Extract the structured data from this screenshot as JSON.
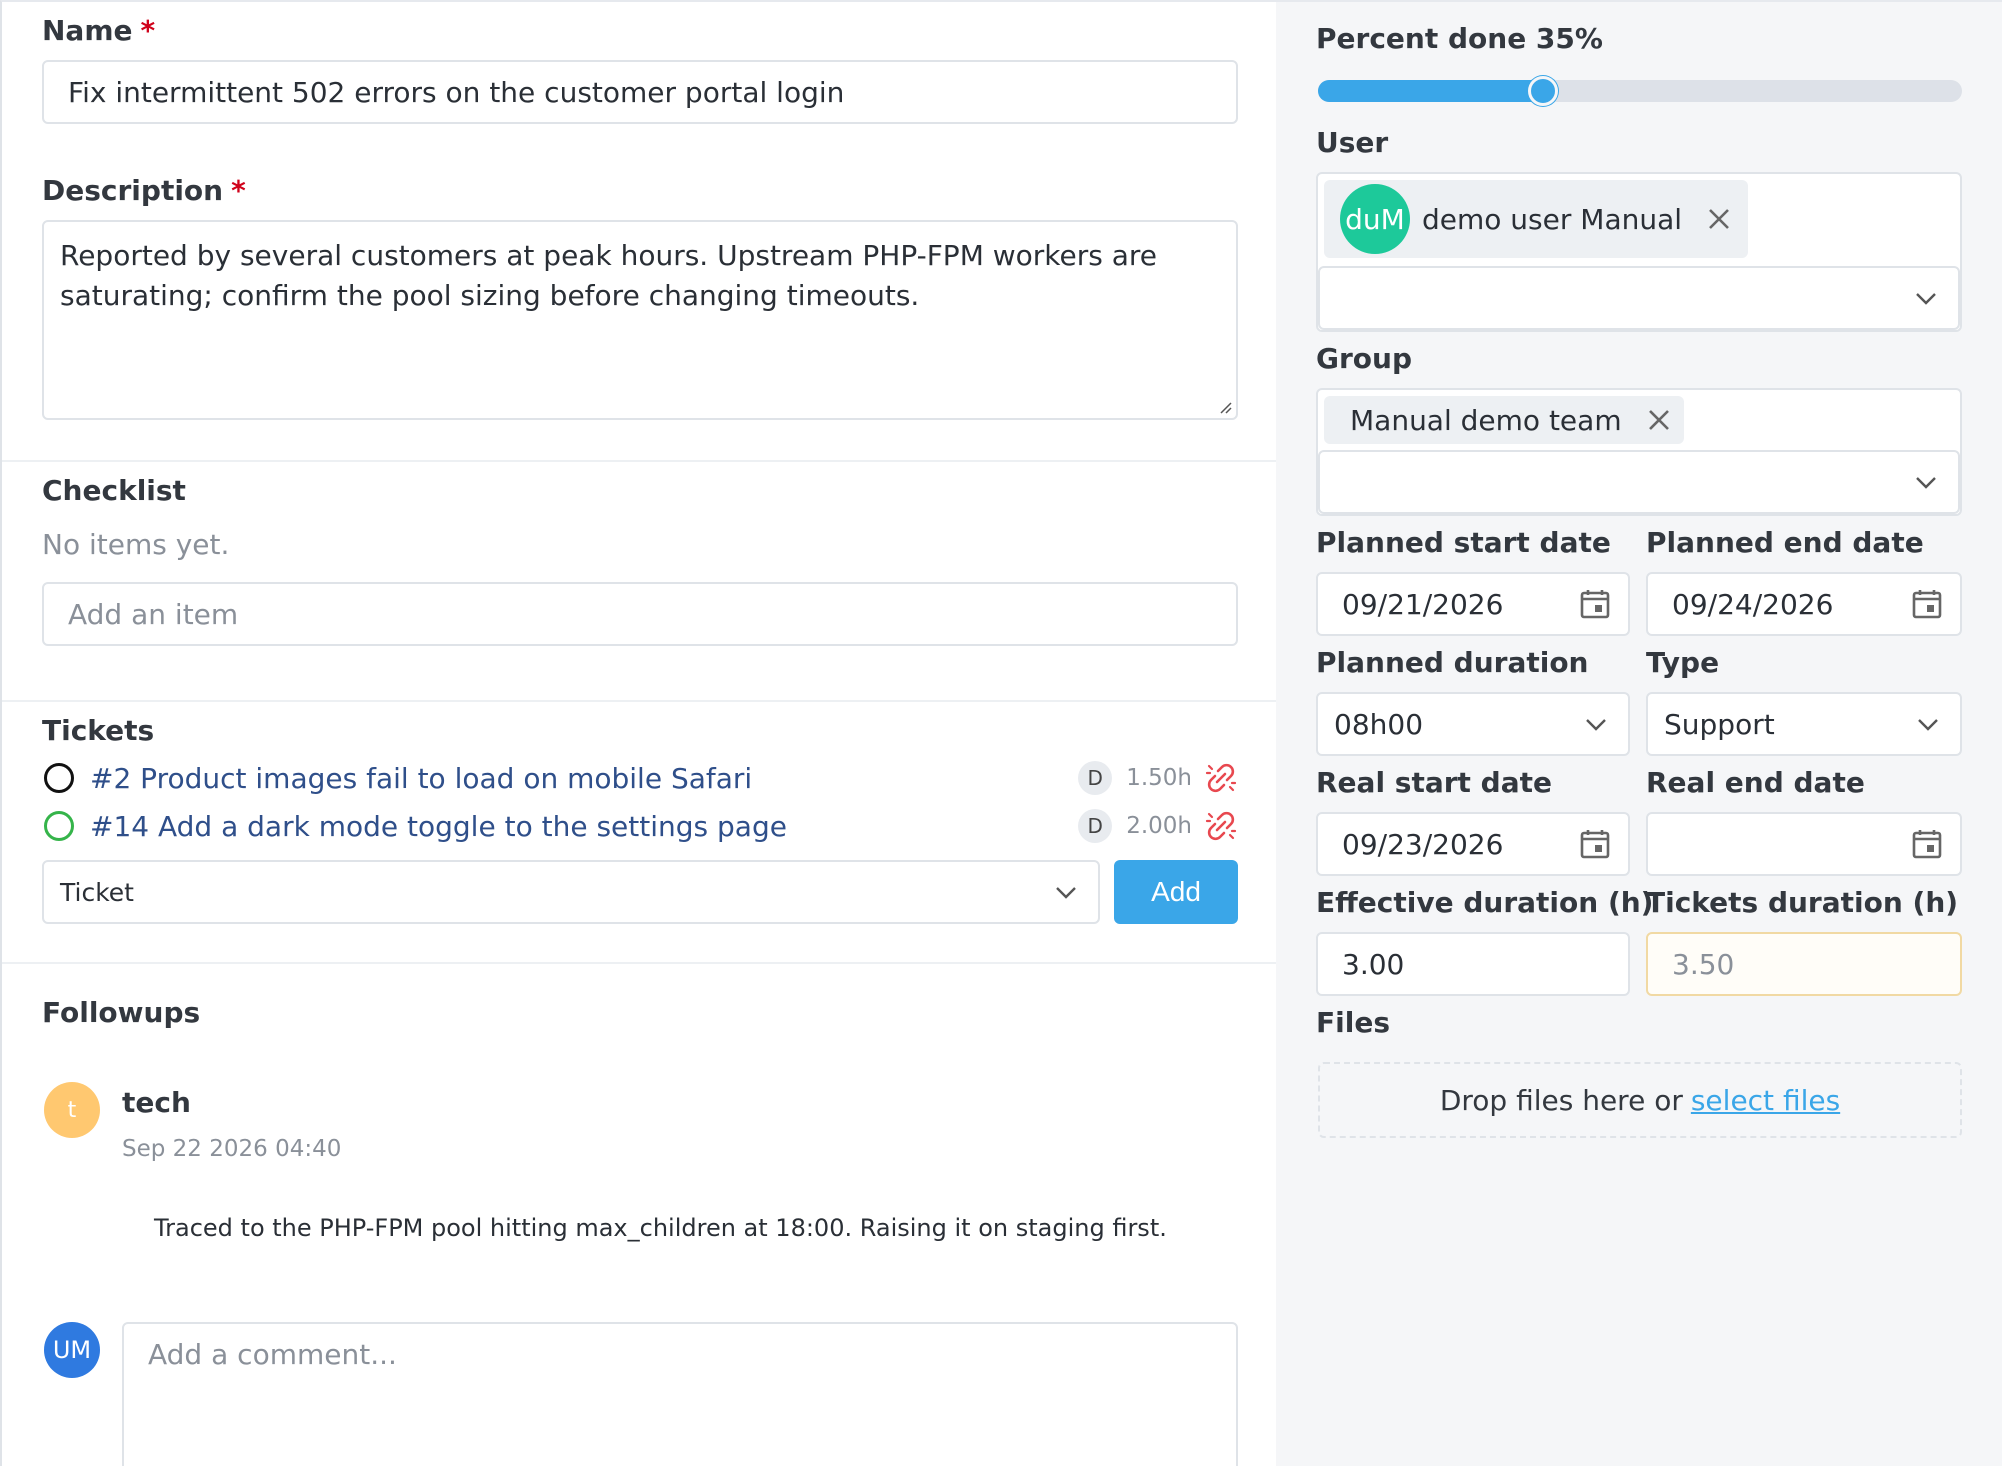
{
  "form": {
    "name_label": "Name",
    "required_mark": "*",
    "name_value": "Fix intermittent 502 errors on the customer portal login",
    "description_label": "Description",
    "description_value": "Reported by several customers at peak hours. Upstream PHP-FPM workers are saturating; confirm the pool sizing before changing timeouts."
  },
  "checklist": {
    "label": "Checklist",
    "empty_text": "No items yet.",
    "add_placeholder": "Add an item"
  },
  "tickets": {
    "label": "Tickets",
    "items": [
      {
        "title": "#2 Product images fail to load on mobile Safari",
        "badge": "D",
        "duration": "1.50h",
        "status_color": "#111111"
      },
      {
        "title": "#14 Add a dark mode toggle to the settings page",
        "badge": "D",
        "duration": "2.00h",
        "status_color": "#35b44a"
      }
    ],
    "select_placeholder": "Ticket",
    "add_label": "Add"
  },
  "followups": {
    "label": "Followups",
    "items": [
      {
        "avatar_initial": "t",
        "author": "tech",
        "date": "Sep 22 2026 04:40",
        "content": "Traced to the PHP-FPM pool hitting max_children at 18:00. Raising it on staging first."
      }
    ],
    "current_user_initials": "UM",
    "comment_placeholder": "Add a comment..."
  },
  "sidebar": {
    "percent_label": "Percent done 35%",
    "percent_value": 35,
    "user_label": "User",
    "user_chip": {
      "initials": "duM",
      "name": "demo user Manual"
    },
    "group_label": "Group",
    "group_chip": {
      "name": "Manual demo team"
    },
    "planned_start_label": "Planned start date",
    "planned_start_value": "09/21/2026",
    "planned_end_label": "Planned end date",
    "planned_end_value": "09/24/2026",
    "planned_duration_label": "Planned duration",
    "planned_duration_value": "08h00",
    "type_label": "Type",
    "type_value": "Support",
    "real_start_label": "Real start date",
    "real_start_value": "09/23/2026",
    "real_end_label": "Real end date",
    "real_end_value": "",
    "effective_duration_label": "Effective duration (h)",
    "effective_duration_value": "3.00",
    "tickets_duration_label": "Tickets duration (h)",
    "tickets_duration_value": "3.50",
    "files_label": "Files",
    "drop_text": "Drop files here or",
    "select_files_link": "select files"
  },
  "colors": {
    "accent": "#3aa6e8",
    "required": "#d0021b",
    "user_avatar": "#1dc99a",
    "followup_avatar": "#ffc870",
    "current_user_avatar": "#2f7ae0",
    "unlink_icon": "#e8484f"
  },
  "icons": {
    "unlink": "unlink-icon",
    "calendar": "calendar-icon",
    "chevron": "chevron-down-icon",
    "close": "close-icon",
    "resize": "resize-handle-icon"
  }
}
